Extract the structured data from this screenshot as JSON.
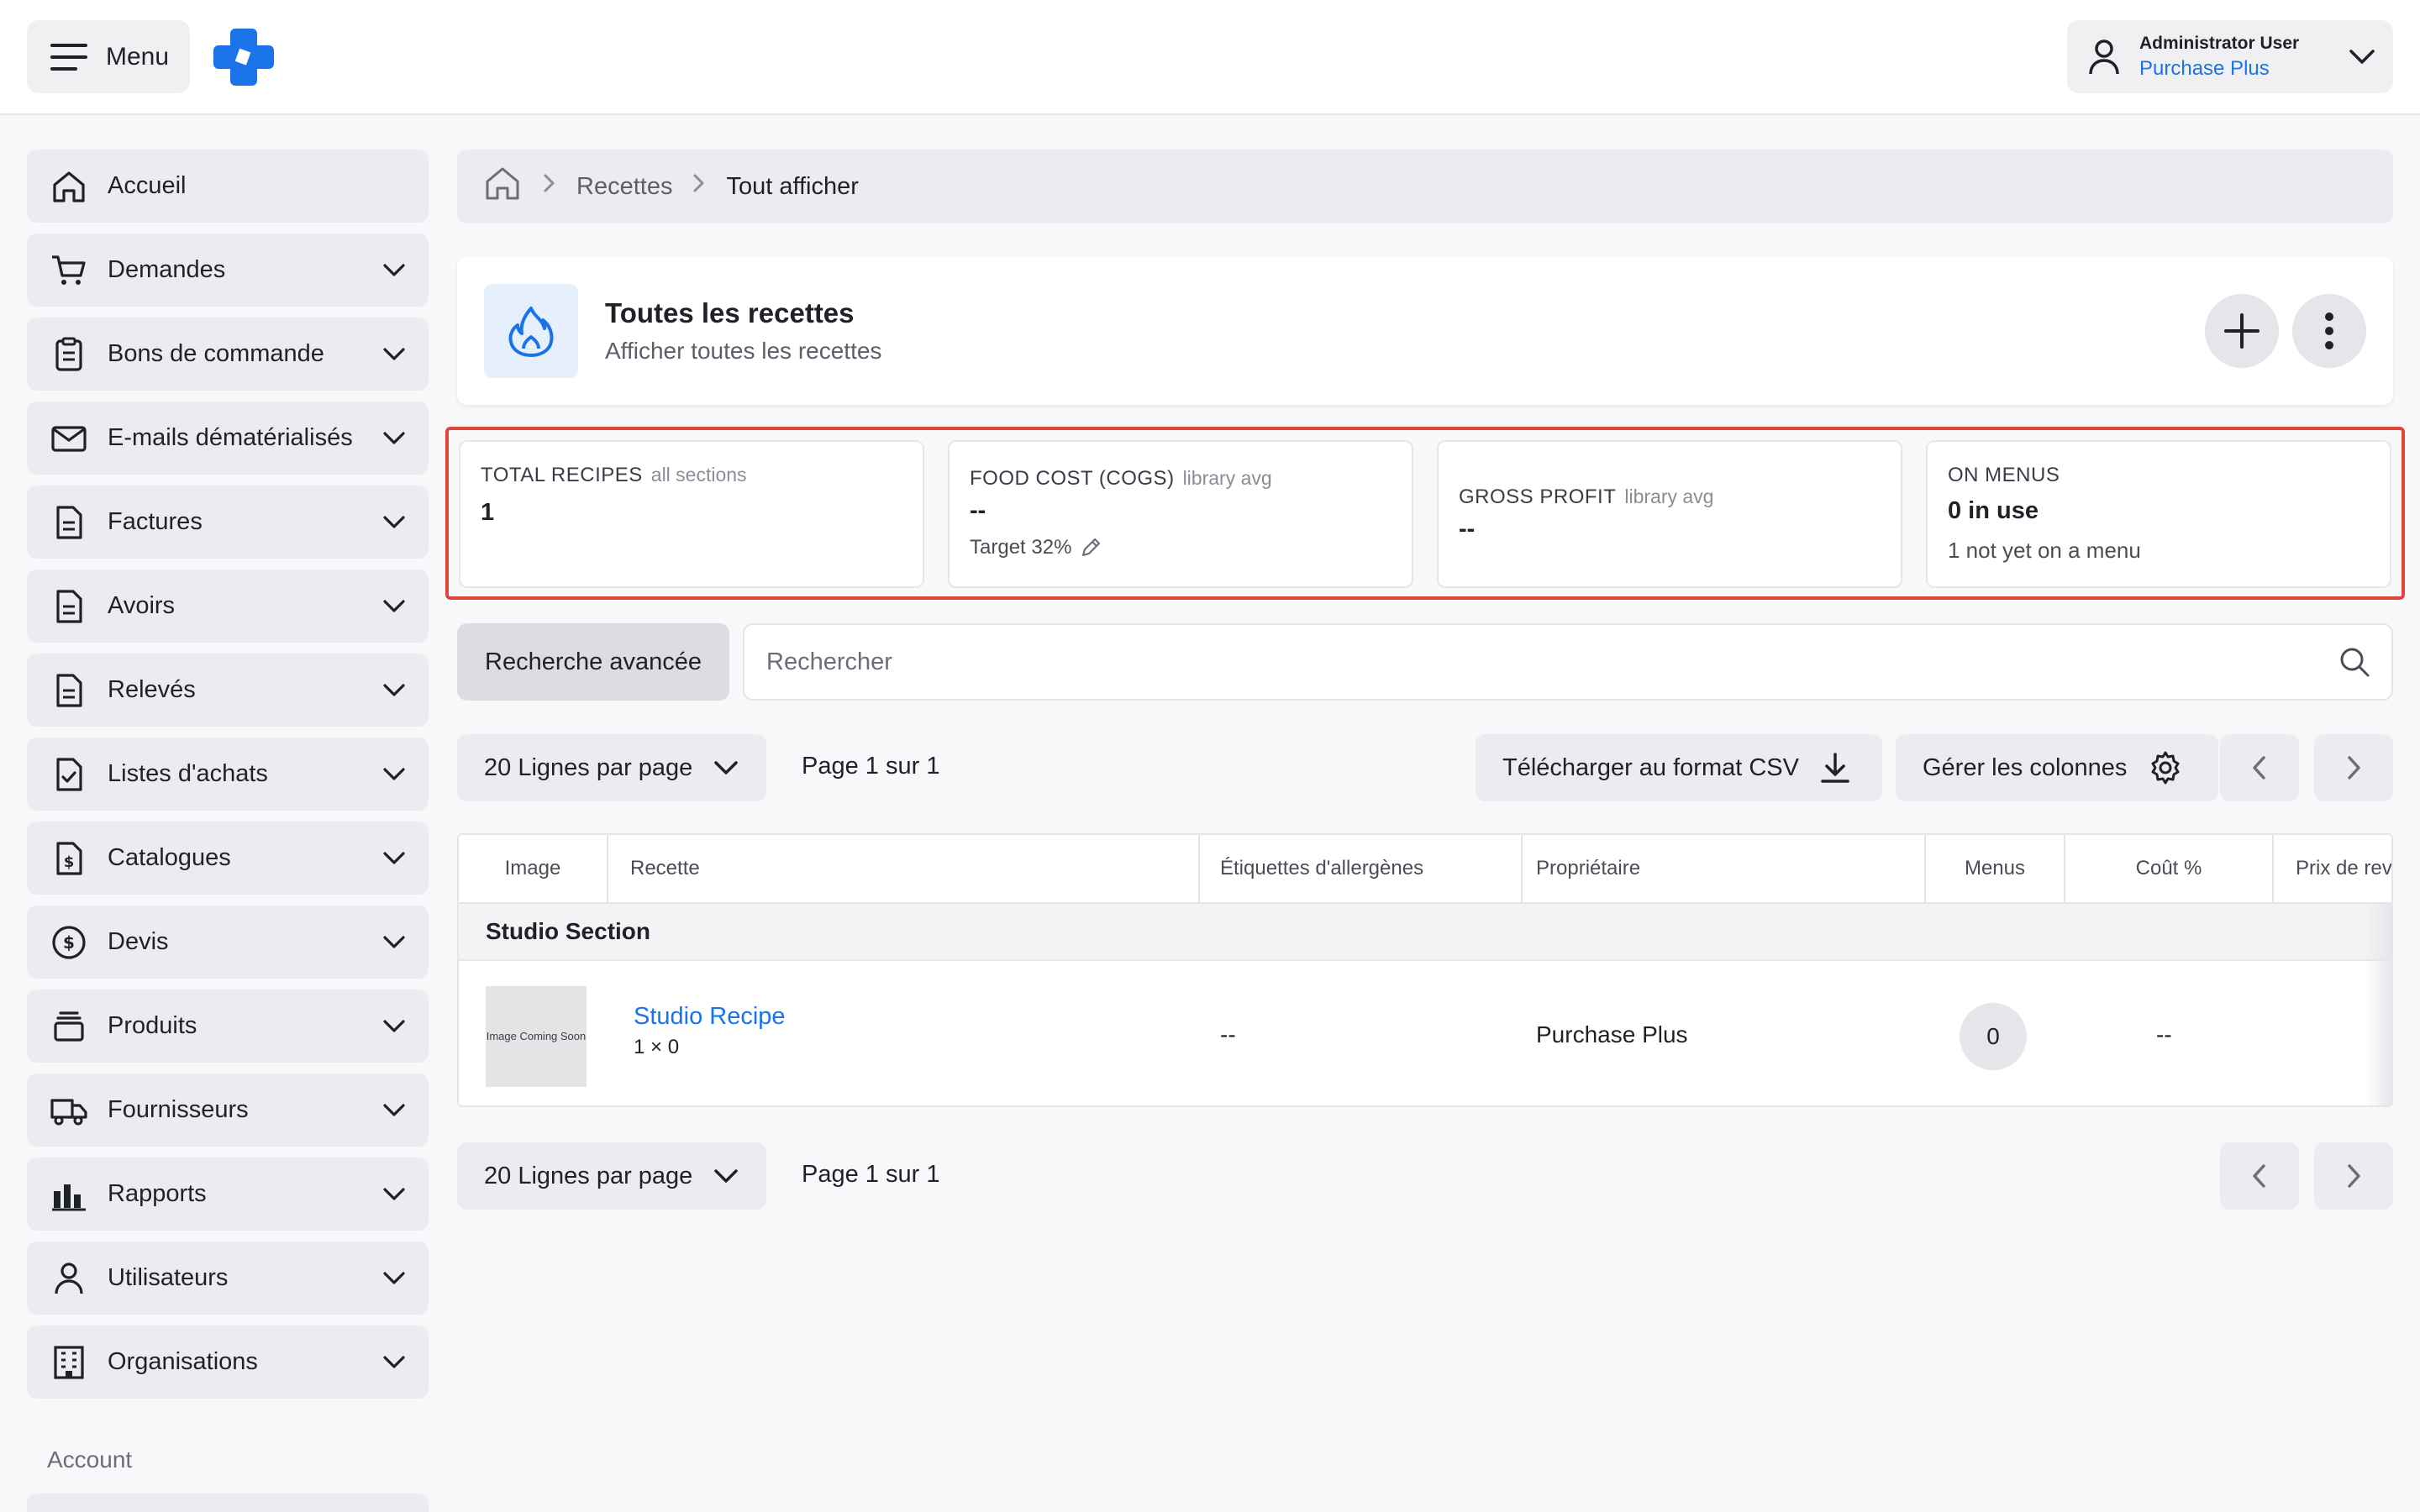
{
  "topbar": {
    "menu_label": "Menu",
    "user_name": "Administrator User",
    "user_org": "Purchase Plus",
    "brand_color": "#1a73e8"
  },
  "sidebar": {
    "items": [
      {
        "label": "Accueil",
        "icon": "home-icon"
      },
      {
        "label": "Demandes",
        "icon": "cart-icon"
      },
      {
        "label": "Bons de commande",
        "icon": "clipboard-icon"
      },
      {
        "label": "E-mails dématérialisés",
        "icon": "mail-icon"
      },
      {
        "label": "Factures",
        "icon": "document-icon"
      },
      {
        "label": "Avoirs",
        "icon": "document-icon"
      },
      {
        "label": "Relevés",
        "icon": "document-icon"
      },
      {
        "label": "Listes d'achats",
        "icon": "checklist-icon"
      },
      {
        "label": "Catalogues",
        "icon": "dollar-document-icon"
      },
      {
        "label": "Devis",
        "icon": "dollar-circle-icon"
      },
      {
        "label": "Produits",
        "icon": "stack-icon"
      },
      {
        "label": "Fournisseurs",
        "icon": "truck-icon"
      },
      {
        "label": "Rapports",
        "icon": "bar-chart-icon"
      },
      {
        "label": "Utilisateurs",
        "icon": "user-icon"
      },
      {
        "label": "Organisations",
        "icon": "building-icon"
      }
    ],
    "section_label": "Account"
  },
  "breadcrumb": {
    "items": [
      "Recettes",
      "Tout afficher"
    ]
  },
  "header": {
    "title": "Toutes les recettes",
    "subtitle": "Afficher toutes les recettes"
  },
  "stats": {
    "total": {
      "title": "TOTAL RECIPES",
      "sub": "all sections",
      "value": "1"
    },
    "food_cost": {
      "title": "FOOD COST (COGS)",
      "sub": "library avg",
      "value": "--",
      "target": "Target 32%"
    },
    "gross_profit": {
      "title": "GROSS PROFIT",
      "sub": "library avg",
      "value": "--"
    },
    "on_menus": {
      "title": "ON MENUS",
      "value": "0 in use",
      "note": "1 not yet on a menu"
    },
    "highlight_color": "#e0473c"
  },
  "search": {
    "advanced_label": "Recherche avancée",
    "placeholder": "Rechercher"
  },
  "toolbar": {
    "rows_per_page": "20 Lignes par page",
    "page_info": "Page 1 sur 1",
    "csv_label": "Télécharger au format CSV",
    "columns_label": "Gérer les colonnes"
  },
  "table": {
    "columns": [
      "Image",
      "Recette",
      "Étiquettes d'allergènes",
      "Propriétaire",
      "Menus",
      "Coût %",
      "Prix de rev"
    ],
    "section": "Studio Section",
    "rows": [
      {
        "image_text": "Image Coming Soon",
        "recipe": "Studio Recipe",
        "recipe_sub": "1 × 0",
        "allergens": "--",
        "owner": "Purchase Plus",
        "menus": "0",
        "cost": "--"
      }
    ]
  },
  "footer": {
    "rows_per_page": "20 Lignes par page",
    "page_info": "Page 1 sur 1"
  }
}
